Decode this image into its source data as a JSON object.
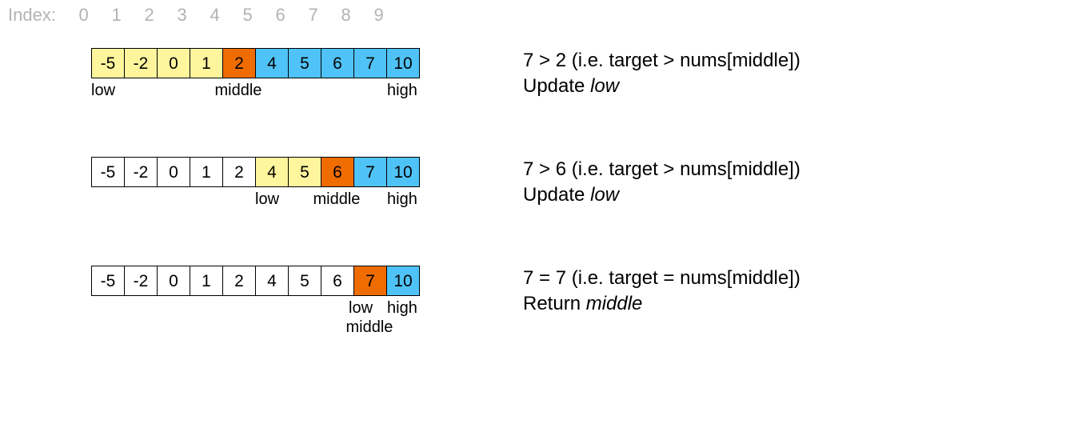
{
  "indexHeader": {
    "label": "Index:",
    "values": [
      "0",
      "1",
      "2",
      "3",
      "4",
      "5",
      "6",
      "7",
      "8",
      "9"
    ]
  },
  "cellWidth": 41,
  "colors": {
    "yellow": "#fff59d",
    "orange": "#ef6c00",
    "blue": "#4fc3f7",
    "white": "#ffffff"
  },
  "steps": [
    {
      "cells": [
        {
          "v": "-5",
          "c": "yellow"
        },
        {
          "v": "-2",
          "c": "yellow"
        },
        {
          "v": "0",
          "c": "yellow"
        },
        {
          "v": "1",
          "c": "yellow"
        },
        {
          "v": "2",
          "c": "orange"
        },
        {
          "v": "4",
          "c": "blue"
        },
        {
          "v": "5",
          "c": "blue"
        },
        {
          "v": "6",
          "c": "blue"
        },
        {
          "v": "7",
          "c": "blue"
        },
        {
          "v": "10",
          "c": "blue"
        }
      ],
      "pointers": [
        {
          "label": "low",
          "idx": 0,
          "row": 0
        },
        {
          "label": "middle",
          "idx": 4,
          "row": 0,
          "center": true
        },
        {
          "label": "high",
          "idx": 9,
          "row": 0,
          "right": true
        }
      ],
      "condition": "7 > 2 (i.e. target > nums[middle])",
      "actionPrefix": "Update ",
      "actionItalic": "low"
    },
    {
      "cells": [
        {
          "v": "-5",
          "c": "white"
        },
        {
          "v": "-2",
          "c": "white"
        },
        {
          "v": "0",
          "c": "white"
        },
        {
          "v": "1",
          "c": "white"
        },
        {
          "v": "2",
          "c": "white"
        },
        {
          "v": "4",
          "c": "yellow"
        },
        {
          "v": "5",
          "c": "yellow"
        },
        {
          "v": "6",
          "c": "orange"
        },
        {
          "v": "7",
          "c": "blue"
        },
        {
          "v": "10",
          "c": "blue"
        }
      ],
      "pointers": [
        {
          "label": "low",
          "idx": 5,
          "row": 0
        },
        {
          "label": "middle",
          "idx": 7,
          "row": 0,
          "center": true
        },
        {
          "label": "high",
          "idx": 9,
          "row": 0,
          "right": true
        }
      ],
      "condition": "7 > 6 (i.e. target > nums[middle])",
      "actionPrefix": "Update ",
      "actionItalic": "low"
    },
    {
      "cells": [
        {
          "v": "-5",
          "c": "white"
        },
        {
          "v": "-2",
          "c": "white"
        },
        {
          "v": "0",
          "c": "white"
        },
        {
          "v": "1",
          "c": "white"
        },
        {
          "v": "2",
          "c": "white"
        },
        {
          "v": "4",
          "c": "white"
        },
        {
          "v": "5",
          "c": "white"
        },
        {
          "v": "6",
          "c": "white"
        },
        {
          "v": "7",
          "c": "orange"
        },
        {
          "v": "10",
          "c": "blue"
        }
      ],
      "pointers": [
        {
          "label": "low",
          "idx": 8,
          "row": 0,
          "xoff": -6
        },
        {
          "label": "high",
          "idx": 9,
          "row": 0,
          "right": true
        },
        {
          "label": "middle",
          "idx": 8,
          "row": 1,
          "center": true
        }
      ],
      "condition": "7 = 7 (i.e. target = nums[middle])",
      "actionPrefix": "Return ",
      "actionItalic": "middle"
    }
  ]
}
